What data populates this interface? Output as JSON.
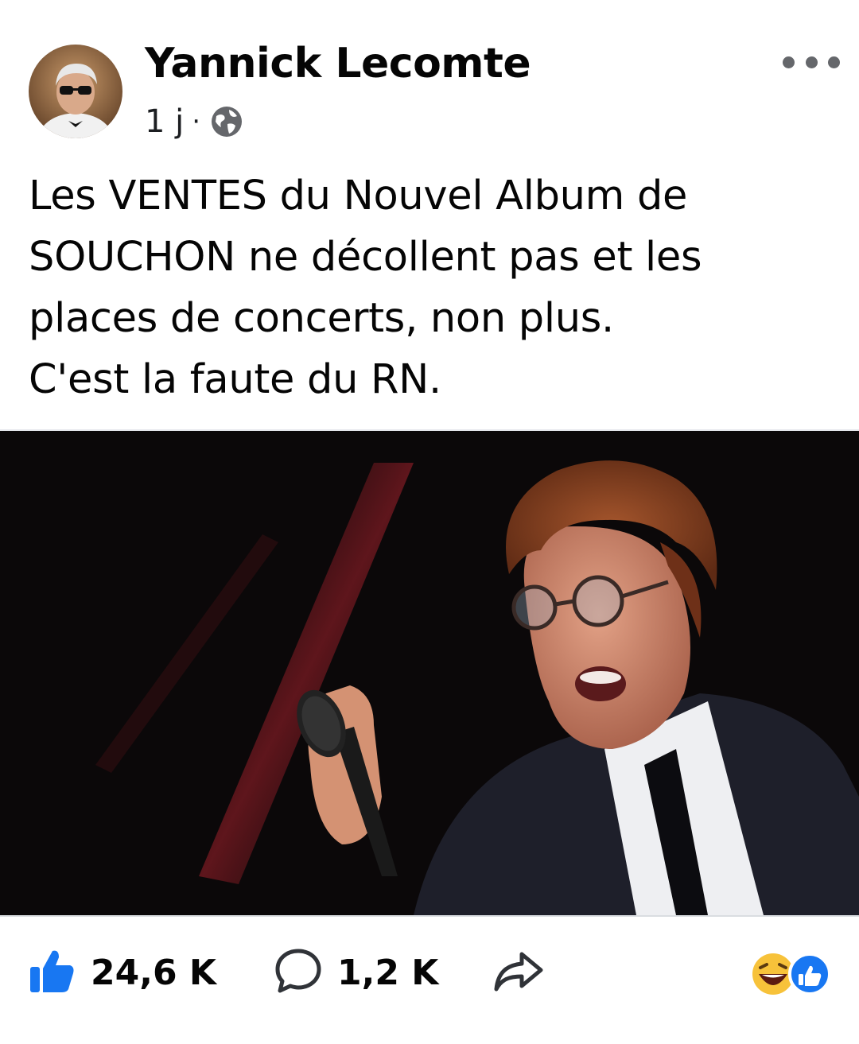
{
  "post": {
    "author": "Yannick Lecomte",
    "time": "1 j",
    "separator": "·",
    "audience_icon": "globe-icon",
    "more_icon": "more-horizontal-icon",
    "text_lines": [
      "Les VENTES du Nouvel Album de",
      "SOUCHON ne décollent pas et les",
      "places de concerts, non plus.",
      "C'est la faute du RN."
    ]
  },
  "footer": {
    "likes": "24,6 K",
    "comments": "1,2 K",
    "like_icon": "thumbs-up-icon",
    "comment_icon": "comment-bubble-icon",
    "share_icon": "share-arrow-icon",
    "reaction_icons": [
      "laughing-emoji-icon",
      "like-reaction-icon"
    ]
  },
  "colors": {
    "text": "#050505",
    "meta": "#65676b",
    "facebook_blue": "#1877f2",
    "photo_background": "#0b0809"
  }
}
